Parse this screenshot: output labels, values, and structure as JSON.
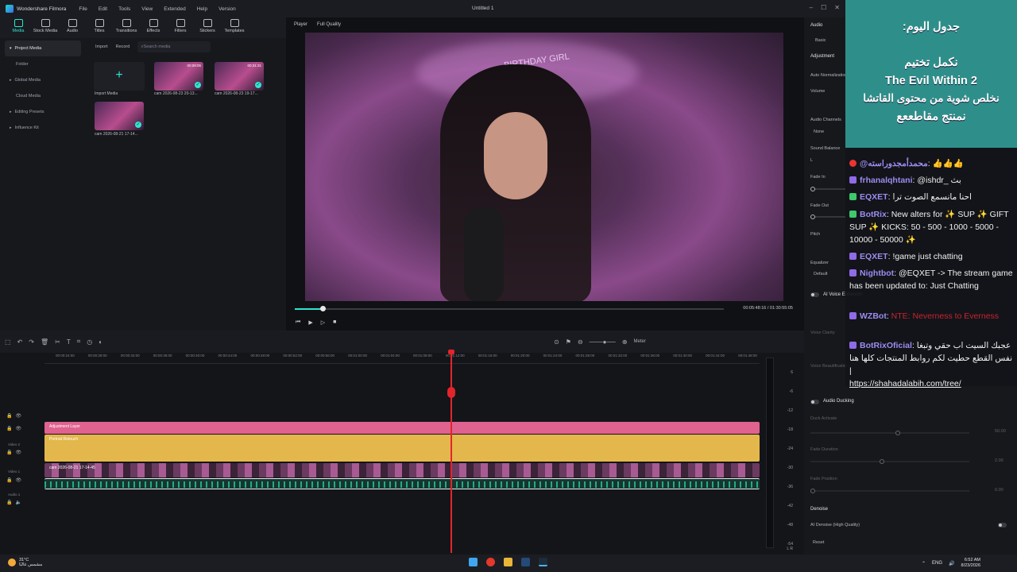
{
  "titlebar": {
    "app_name": "Wondershare Filmora",
    "menu": [
      "File",
      "Edit",
      "Tools",
      "View",
      "Extended",
      "Help",
      "Version"
    ],
    "document": "Untitled 1"
  },
  "toolbar": {
    "items": [
      {
        "label": "Media",
        "icon": "media-icon",
        "active": true
      },
      {
        "label": "Stock Media",
        "icon": "stock-media-icon"
      },
      {
        "label": "Audio",
        "icon": "audio-icon"
      },
      {
        "label": "Titles",
        "icon": "titles-icon"
      },
      {
        "label": "Transitions",
        "icon": "transitions-icon"
      },
      {
        "label": "Effects",
        "icon": "effects-icon"
      },
      {
        "label": "Filters",
        "icon": "filters-icon"
      },
      {
        "label": "Stickers",
        "icon": "stickers-icon"
      },
      {
        "label": "Templates",
        "icon": "templates-icon"
      }
    ]
  },
  "sidebar": {
    "items": [
      "Project Media",
      "Folder",
      "Global Media",
      "Cloud Media",
      "Editing Presets",
      "Influence Kit"
    ]
  },
  "media": {
    "import_label": "Import",
    "record_label": "Record",
    "search_placeholder": "Search media",
    "import_media_label": "Import Media",
    "clips": [
      {
        "name": "cam 2026-08-23 20-13...",
        "duration": "00:08:05"
      },
      {
        "name": "cam 2026-08-23 19-17...",
        "duration": "00:31:31"
      },
      {
        "name": "cam 2026-08-21 17-14..."
      }
    ]
  },
  "player": {
    "label": "Player",
    "quality": "Full Quality",
    "current_time": "00:05:48:16",
    "total_time": "/ 01:30:55:05",
    "progress": 0.064,
    "banner_text": "BIRTHDAY GIRL"
  },
  "props": {
    "tab_audio": "Audio",
    "tab_basic": "Basic",
    "adjustment": "Adjustment",
    "auto_normalize": "Auto Normalization",
    "volume": "Volume",
    "audio_channels": "Audio Channels",
    "audio_channels_value": "None",
    "sound_balance": "Sound Balance",
    "l_label": "L",
    "fade_in": "Fade In",
    "fade_out": "Fade Out",
    "pitch": "Pitch",
    "equalizer": "Equalizer",
    "equalizer_value": "Default",
    "ai_voice": "AI Voice Enhancer",
    "voice_clarity": "Voice Clarity",
    "voice_beautification": "Voice Beautification",
    "audio_ducking": "Audio Ducking",
    "duck_activate": "Duck Activate",
    "duck_value": "50.00",
    "fade_duration": "Fade Duration",
    "fade_duration_value": "2.00",
    "fade_position": "Fade Position",
    "fade_position_value": "0.00",
    "denoise": "Denoise",
    "ai_denoise": "AI Denoise (High Quality)",
    "reset": "Reset"
  },
  "schedule": {
    "lines": [
      "جدول اليوم:",
      "",
      "نكمل تختيم",
      "The Evil Within 2",
      "نخلص شوية من محتوى القاتشا",
      "نمنتج مقاطععع"
    ]
  },
  "chat": {
    "messages": [
      {
        "user": "@محمدأمجدوراسته",
        "text": "👍👍👍",
        "color": "#9b8cf0",
        "icon_color": "#e33"
      },
      {
        "user": "frhanalqhtani",
        "text": "@ishdr_ بث",
        "color": "#9b8cf0",
        "icon_color": "#8f6be8"
      },
      {
        "user": "EQXET",
        "text": "احنا مانسمع الصوت ترا",
        "color": "#9b8cf0",
        "icon_color": "#3fc86e"
      },
      {
        "user": "BotRix",
        "text": "New alters for ✨ SUP ✨ GIFT SUP ✨ KICKS: 50 - 500 - 1000 - 5000 - 10000 - 50000 ✨",
        "color": "#9b8cf0",
        "icon_color": "#3fc86e"
      },
      {
        "user": "EQXET",
        "text": "!game just chatting",
        "color": "#9b8cf0",
        "icon_color": "#8f6be8"
      },
      {
        "user": "Nightbot",
        "text": "@EQXET -> The stream game has been updated to: Just Chatting",
        "color": "#9b8cf0",
        "icon_color": "#8f6be8"
      },
      {
        "user": "WZBot",
        "text": "NTE: Neverness to Everness",
        "color": "#9b8cf0",
        "icon_color": "#8f6be8"
      },
      {
        "user": "BotRixOficial",
        "text": "عجبك السيت اب حقي وتبغا نفس القطع حطيت لكم روابط المنتجات كلها هنا |",
        "link": "https://shahadalabih.com/tree/",
        "color": "#9b8cf0",
        "icon_color": "#8f6be8"
      }
    ]
  },
  "timeline": {
    "ruler": [
      "00:00:24:00",
      "00:00:28:00",
      "00:00:32:00",
      "00:00:36:00",
      "00:00:40:00",
      "00:00:44:00",
      "00:00:48:00",
      "00:00:52:00",
      "00:00:56:00",
      "00:01:00:00",
      "00:01:04:00",
      "00:01:08:00",
      "00:01:12:00",
      "00:01:16:00",
      "00:01:20:00",
      "00:01:24:00",
      "00:01:28:00",
      "00:01:32:00",
      "00:01:36:00",
      "00:01:40:00",
      "00:01:44:00",
      "00:01:48:00"
    ],
    "tracks": {
      "adjustment": "Adjustment Layer",
      "portrait": "Portrait Retouch",
      "cam": "cam 2026-08-21 17-14-45"
    },
    "track_names": [
      "Video 2",
      "Video 1",
      "Audio 1"
    ],
    "meter_label": "Meter",
    "meter_levels": [
      "6",
      "-6",
      "-12",
      "-18",
      "-24",
      "-30",
      "-36",
      "-42",
      "-48",
      "-54"
    ],
    "meter_lr": "L R"
  },
  "taskbar": {
    "temp": "31°C",
    "weather": "مشمس غالبًا",
    "lang": "ENG",
    "time": "6:52 AM",
    "date": "8/23/2026"
  }
}
